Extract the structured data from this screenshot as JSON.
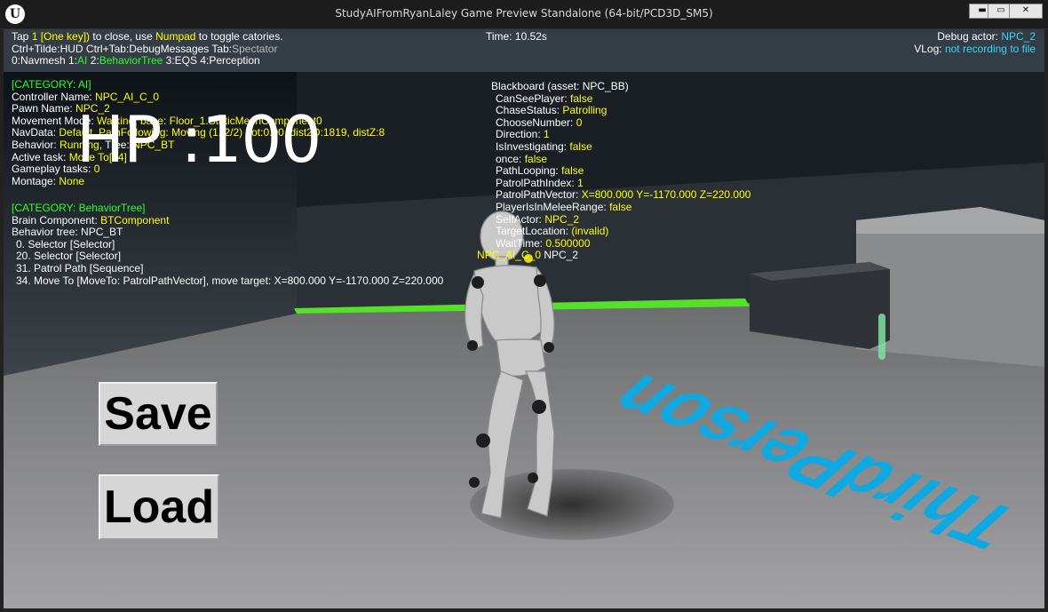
{
  "window": {
    "title": "StudyAIFromRyanLaley Game Preview Standalone (64-bit/PCD3D_SM5)",
    "logo_glyph": "U",
    "min_glyph": "▬",
    "max_glyph": "▭",
    "close_glyph": "✕"
  },
  "hud": {
    "tap_pre": "Tap ",
    "tap_key": "1 [One key])",
    "tap_mid": " to close, use ",
    "tap_numpad": "Numpad",
    "tap_post": " to toggle catories.",
    "line2_a": "Ctrl+Tilde:HUD  Ctrl+Tab:DebugMessages  Tab:",
    "line2_spectator": "Spectator",
    "line3_navmesh": "0:Navmesh  1:",
    "line3_ai": "AI",
    "line3_mid": "  2:",
    "line3_bt": "BehaviorTree",
    "line3_rest": "  3:EQS  4:Perception",
    "time": "Time: 10.52s",
    "debug_actor_label": "Debug actor: ",
    "debug_actor": "NPC_2",
    "vlog_label": "VLog: ",
    "vlog_value": "not recording to file"
  },
  "ai_category": {
    "header": "[CATEGORY: AI]",
    "controller_label": "Controller Name: ",
    "controller": "NPC_AI_C_0",
    "pawn_label": "Pawn Name: ",
    "pawn": "NPC_2",
    "movement_label": "Movement Mode: ",
    "movement": "Walking, base: Floor_1.StaticMeshComponent0",
    "navdata_label": "NavData: ",
    "navdata": "Default, PathFollowing: Moving (1..2/2) dot:0.00, dist2D:1819, distZ:8",
    "behavior_label": "Behavior: ",
    "behavior": "Running",
    "tree_label": ", Tree: ",
    "tree": "NPC_BT",
    "active_task_label": "Active task: ",
    "active_task": "Move To[34]",
    "gameplay_tasks_label": "Gameplay tasks: ",
    "gameplay_tasks": "0",
    "montage_label": "Montage: ",
    "montage": "None"
  },
  "bt_category": {
    "header": "[CATEGORY: BehaviorTree]",
    "brain_label": "Brain Component: ",
    "brain": "BTComponent",
    "tree_line": "Behavior tree: NPC_BT",
    "nodes": [
      "0. Selector [Selector]",
      "20. Selector [Selector]",
      "31. Patrol Path [Sequence]",
      "34. Move To [MoveTo: PatrolPathVector], move target: X=800.000 Y=-1170.000 Z=220.000"
    ]
  },
  "blackboard": {
    "header": "Blackboard (asset: NPC_BB)",
    "entries": [
      {
        "key": "CanSeePlayer: ",
        "value": "false"
      },
      {
        "key": "ChaseStatus: ",
        "value": "Patrolling"
      },
      {
        "key": "ChooseNumber: ",
        "value": "0"
      },
      {
        "key": "Direction: ",
        "value": "1"
      },
      {
        "key": "IsInvestigating: ",
        "value": "false"
      },
      {
        "key": "once: ",
        "value": "false"
      },
      {
        "key": "PathLooping: ",
        "value": "false"
      },
      {
        "key": "PatrolPathIndex: ",
        "value": "1"
      },
      {
        "key": "PatrolPathVector: ",
        "value": "X=800.000 Y=-1170.000 Z=220.000"
      },
      {
        "key": "PlayerIsInMeleeRange: ",
        "value": "false"
      },
      {
        "key": "SelfActor: ",
        "value": "NPC_2"
      },
      {
        "key": "TargetLocation: ",
        "value": "(invalid)"
      },
      {
        "key": "WaitTime: ",
        "value": "0.500000"
      }
    ]
  },
  "npc_label": {
    "controller": "NPC_AI_C_0",
    "pawn": " NPC_2"
  },
  "game_ui": {
    "hp_text": "HP :100",
    "save_label": "Save",
    "load_label": "Load"
  },
  "floor_text": "ThirdPerson",
  "colors": {
    "hud_value": "#ffff00",
    "hud_category": "#2bff2b",
    "hud_link": "#36d6ff",
    "floor_text": "#10a8e0",
    "nav_strip": "#55e02a"
  }
}
